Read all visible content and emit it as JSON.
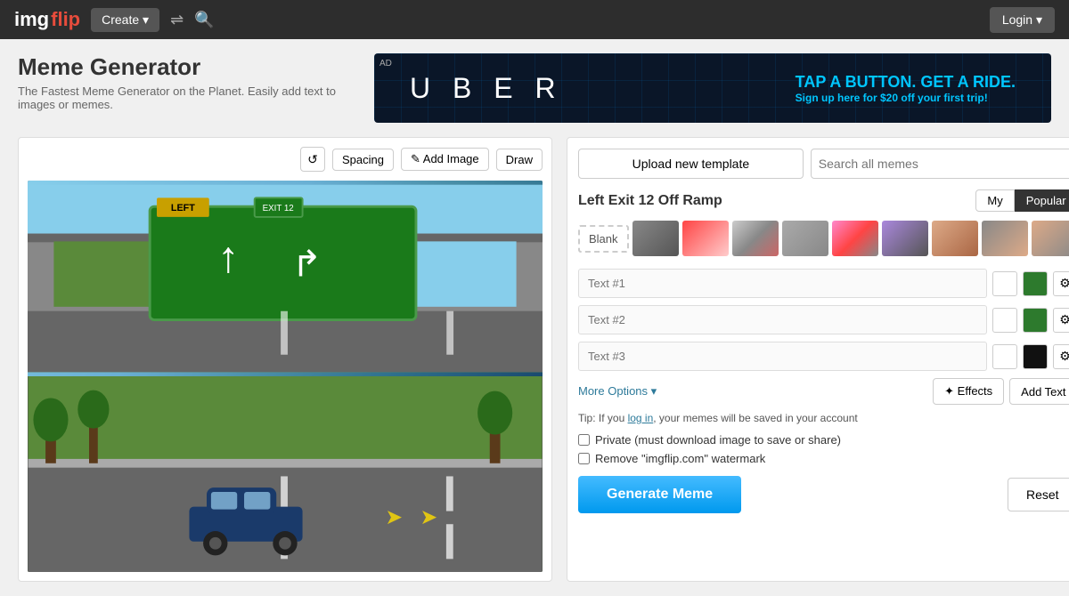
{
  "navbar": {
    "logo_img": "img",
    "logo_flip": "flip",
    "create_label": "Create ▾",
    "login_label": "Login ▾"
  },
  "header": {
    "title": "Meme Generator",
    "subtitle": "The Fastest Meme Generator on the Planet. Easily add text to images or memes."
  },
  "ad": {
    "label": "AD",
    "logo": "U B E R",
    "headline": "TAP A BUTTON. GET A RIDE.",
    "subtext_prefix": "Sign up here for ",
    "discount": "$20",
    "subtext_suffix": " off your first trip!"
  },
  "toolbar": {
    "spacing_label": "Spacing",
    "add_image_label": "✎ Add Image",
    "draw_label": "Draw"
  },
  "right_panel": {
    "upload_label": "Upload new template",
    "search_placeholder": "Search all memes",
    "template_title": "Left Exit 12 Off Ramp",
    "tab_my": "My",
    "tab_popular": "Popular",
    "blank_label": "Blank",
    "text1_placeholder": "Text #1",
    "text2_placeholder": "Text #2",
    "text3_placeholder": "Text #3",
    "more_options_label": "More Options ▾",
    "effects_label": "✦ Effects",
    "add_text_label": "Add Text",
    "tip_prefix": "Tip: If you ",
    "tip_link": "log in",
    "tip_suffix": ", your memes will be saved in your account",
    "private_label": "Private (must download image to save or share)",
    "watermark_label": "Remove \"imgflip.com\" watermark",
    "generate_label": "Generate Meme",
    "reset_label": "Reset"
  }
}
